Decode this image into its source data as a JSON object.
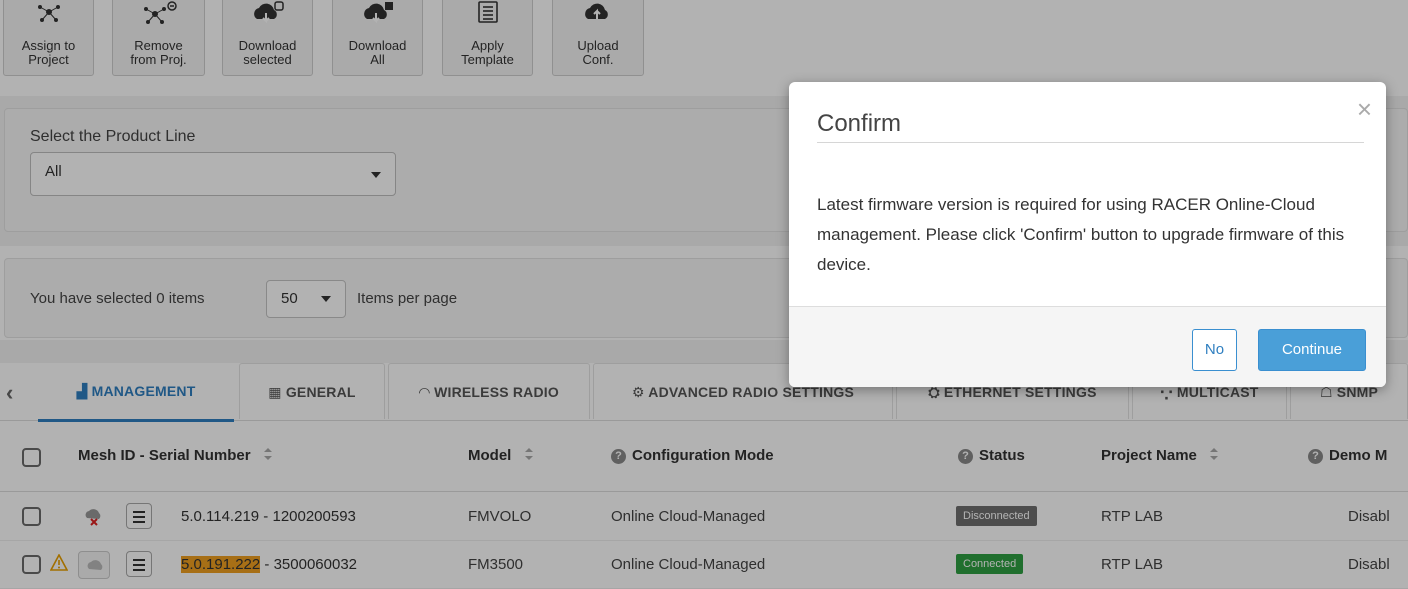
{
  "toolbar": {
    "assign_label_1": "Assign to",
    "assign_label_2": "Project",
    "remove_label_1": "Remove",
    "remove_label_2": "from Proj.",
    "download_sel_label_1": "Download",
    "download_sel_label_2": "selected",
    "download_all_label_1": "Download",
    "download_all_label_2": "All",
    "apply_label_1": "Apply",
    "apply_label_2": "Template",
    "upload_label_1": "Upload",
    "upload_label_2": "Conf."
  },
  "filters": {
    "product_line_label": "Select the Product Line",
    "product_line_value": "All"
  },
  "selection": {
    "selected_text": "You have selected 0 items",
    "per_page_value": "50",
    "per_page_label": "Items per page"
  },
  "tabs": [
    {
      "label": "MANAGEMENT",
      "icon": "management-icon",
      "active": true
    },
    {
      "label": "GENERAL",
      "icon": "grid-icon"
    },
    {
      "label": "WIRELESS RADIO",
      "icon": "wifi-icon"
    },
    {
      "label": "ADVANCED RADIO SETTINGS",
      "icon": "gears-icon"
    },
    {
      "label": "ETHERNET SETTINGS",
      "icon": "ethernet-icon"
    },
    {
      "label": "MULTICAST",
      "icon": "multicast-icon"
    },
    {
      "label": "SNMP",
      "icon": "snmp-icon"
    }
  ],
  "table": {
    "headers": {
      "mesh_id": "Mesh ID - Serial Number",
      "model": "Model",
      "config_mode": "Configuration Mode",
      "status": "Status",
      "project": "Project Name",
      "demo": "Demo M"
    },
    "rows": [
      {
        "mesh_id": "5.0.114.219",
        "serial": " - 1200200593",
        "model": "FMVOLO",
        "config_mode": "Online Cloud-Managed",
        "status": "Disconnected",
        "project": "RTP LAB",
        "demo": "Disabl"
      },
      {
        "mesh_id": "5.0.191.222",
        "serial": " - 3500060032",
        "model": "FM3500",
        "config_mode": "Online Cloud-Managed",
        "status": "Connected",
        "project": "RTP LAB",
        "demo": "Disabl"
      }
    ]
  },
  "modal": {
    "title": "Confirm",
    "close": "×",
    "body": "Latest firmware version is required for using RACER Online-Cloud management. Please click 'Confirm' button to upgrade firmware of this device.",
    "no_label": "No",
    "continue_label": "Continue"
  },
  "colors": {
    "accent": "#2f7fc0",
    "continue_bg": "#4a9fd8",
    "disconnected": "#6f6f6f",
    "connected": "#2ea043",
    "highlight": "#f0a020",
    "warning": "#e8a000"
  }
}
